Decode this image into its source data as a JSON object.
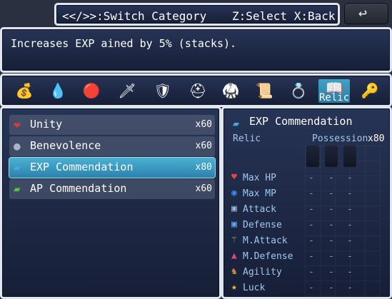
{
  "help": {
    "switch_hint": "<</>>:Switch Category",
    "select_hint": "Z:Select X:Back"
  },
  "back_button": {
    "icon": "undo-arrow-icon",
    "glyph": "↩"
  },
  "description": "Increases EXP ained by 5% (stacks).",
  "categories": {
    "selected_label": "Relic",
    "items": [
      {
        "icon": "money-bag-icon",
        "glyph": "💰"
      },
      {
        "icon": "potion-icon",
        "glyph": "💧"
      },
      {
        "icon": "orb-icon",
        "glyph": "🔴"
      },
      {
        "icon": "sword-icon",
        "glyph": "🗡"
      },
      {
        "icon": "shield-icon",
        "glyph": "🛡"
      },
      {
        "icon": "helmet-icon",
        "glyph": "⛑"
      },
      {
        "icon": "armor-icon",
        "glyph": "🥋"
      },
      {
        "icon": "scroll-icon",
        "glyph": "📜"
      },
      {
        "icon": "ring-icon",
        "glyph": "💍"
      },
      {
        "icon": "relic-book-icon",
        "glyph": "📖"
      },
      {
        "icon": "key-icon",
        "glyph": "🔑"
      }
    ]
  },
  "items": [
    {
      "name": "Unity",
      "qty": "x60",
      "icon": "heart-icon",
      "glyph": "❤",
      "color": "#d83a3a"
    },
    {
      "name": "Benevolence",
      "qty": "x60",
      "icon": "sphere-icon",
      "glyph": "●",
      "color": "#a8b4c8"
    },
    {
      "name": "EXP Commendation",
      "qty": "x80",
      "icon": "blue-book-icon",
      "glyph": "▰",
      "color": "#4aa5e8"
    },
    {
      "name": "AP Commendation",
      "qty": "x60",
      "icon": "green-book-icon",
      "glyph": "▰",
      "color": "#55c04a"
    }
  ],
  "status": {
    "name": "EXP Commendation",
    "type": "Relic",
    "possession_label": "Possession",
    "possession_value": "x80",
    "params": [
      {
        "label": "Max HP",
        "icon": "heart-icon",
        "glyph": "♥",
        "color": "#e04848"
      },
      {
        "label": "Max MP",
        "icon": "mana-orb-icon",
        "glyph": "◉",
        "color": "#3b8ef0"
      },
      {
        "label": "Attack",
        "icon": "sword-tile-icon",
        "glyph": "▣",
        "color": "#9cb6d8"
      },
      {
        "label": "Defense",
        "icon": "shield-tile-icon",
        "glyph": "▣",
        "color": "#5aa8f0"
      },
      {
        "label": "M.Attack",
        "icon": "wand-icon",
        "glyph": "⚚",
        "color": "#8ed04a"
      },
      {
        "label": "M.Defense",
        "icon": "wizard-hat-icon",
        "glyph": "▲",
        "color": "#d84a7a"
      },
      {
        "label": "Agility",
        "icon": "boot-icon",
        "glyph": "♞",
        "color": "#c8883a"
      },
      {
        "label": "Luck",
        "icon": "star-icon",
        "glyph": "★",
        "color": "#f0c040"
      }
    ],
    "dash": "-"
  }
}
